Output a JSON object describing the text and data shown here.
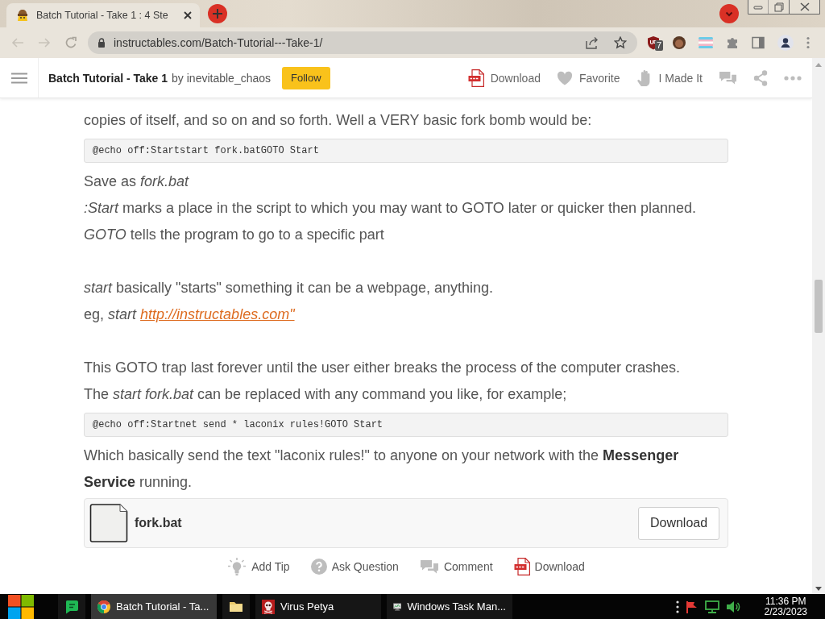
{
  "browser": {
    "tabs": [
      {
        "title": "Batch Tutorial - Take 1 : 4 Ste",
        "selected": true
      }
    ],
    "address": "instructables.com/Batch-Tutorial---Take-1/",
    "extension_badge": "7"
  },
  "header": {
    "title": "Batch Tutorial - Take 1",
    "byline": "by inevitable_chaos",
    "follow_button": "Follow",
    "actions": [
      {
        "kind": "pdf",
        "label": "Download"
      },
      {
        "kind": "heart",
        "label": "Favorite"
      },
      {
        "kind": "hand",
        "label": "I Made It"
      }
    ]
  },
  "article": {
    "blocks": [
      {
        "kind": "paragraph",
        "text": "copies of itself, and so on and so forth. Well a VERY basic fork bomb would be:"
      },
      {
        "kind": "code",
        "text": "@echo off:Startstart fork.batGOTO Start"
      },
      {
        "kind": "paragraph",
        "text": "Save as *fork.bat*"
      },
      {
        "kind": "paragraph",
        "text": "*:Start* marks a place in the script to which you may want to GOTO later or quicker then planned."
      },
      {
        "kind": "paragraph",
        "text": "*GOTO* tells the program to go to a specific part"
      },
      {
        "kind": "blank"
      },
      {
        "kind": "paragraph",
        "text": "*start* basically \"starts\" something it can be a webpage, anything."
      },
      {
        "kind": "paragraph",
        "text": "eg, *start*",
        "link": "http://instructables.com\""
      },
      {
        "kind": "blank"
      },
      {
        "kind": "paragraph",
        "text": "This GOTO trap last forever until the user either breaks the process of the computer crashes."
      },
      {
        "kind": "paragraph",
        "text": "The *start fork.bat* can be replaced with any command you like, for example;"
      },
      {
        "kind": "code",
        "text": "@echo off:Startnet send * laconix rules!GOTO Start"
      },
      {
        "kind": "paragraph",
        "text": "Which basically send the text \"laconix rules!\" to anyone on your network with the **Messenger Service** running."
      }
    ],
    "attachment": {
      "name": "fork.bat",
      "button": "Download"
    },
    "step_actions": [
      {
        "kind": "tip",
        "label": "Add Tip"
      },
      {
        "kind": "question",
        "label": "Ask Question"
      },
      {
        "kind": "comment",
        "label": "Comment"
      },
      {
        "kind": "pdf",
        "label": "Download"
      }
    ]
  },
  "taskbar": {
    "items": [
      {
        "kind": "chat",
        "selected": false
      },
      {
        "kind": "browser",
        "label": "Batch Tutorial - Ta...",
        "selected": true
      },
      {
        "kind": "folder",
        "selected": false
      },
      {
        "kind": "skull",
        "label": "Virus Petya",
        "selected": false
      },
      {
        "kind": "monitor",
        "label": "Windows Task Man...",
        "selected": false
      }
    ],
    "clock": {
      "time": "11:36 PM",
      "date": "2/23/2023"
    }
  }
}
